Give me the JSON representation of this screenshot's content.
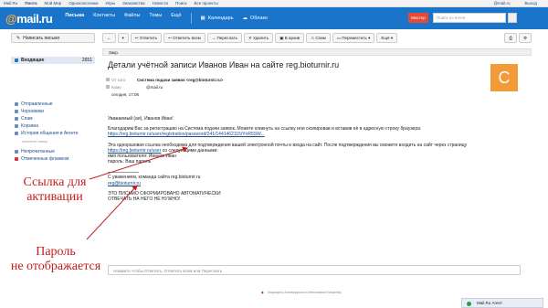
{
  "portal": {
    "items": [
      "Mail.Ru",
      "Почта",
      "Мой Мир",
      "Одноклассники",
      "Игры",
      "Знакомства",
      "Новости",
      "Поиск",
      "Все проекты"
    ],
    "right": [
      "@mail.ru",
      "Выход"
    ]
  },
  "header": {
    "logo_main": "@mail.ru",
    "nav": [
      "Письма",
      "Контакты",
      "Файлы",
      "Темы",
      "Ещё"
    ],
    "calendar": "Календарь",
    "cloud": "Облако",
    "red_button": "Мистер",
    "search_placeholder": "Поиск по почте"
  },
  "sidebar": {
    "compose": "Написать письмо",
    "inbox": "Входящие",
    "inbox_count": "2651",
    "folders": [
      "Отправленные",
      "Черновики",
      "Спам",
      "Корзина",
      "История общения в Агенте"
    ],
    "clear": "очистить папку",
    "unread": "Непрочитанные",
    "flagged": "Отмеченные флажком"
  },
  "toolbar": {
    "buttons": [
      "Ответить",
      "Ответить всем",
      "Переслать",
      "Удалить",
      "В архив",
      "Спам",
      "Переместить",
      "Ещё"
    ]
  },
  "tabbar": {
    "label": "Закр."
  },
  "message": {
    "subject": "Детали учётной записи Иванов Иван на сайте reg.bioturnir.ru",
    "avatar_letter": "С",
    "from_key": "От кого",
    "from_val": "Система подачи заявок <reg@bioturnir.ru>",
    "to_key": "Кому",
    "to_val": "@mail.ru",
    "date": "сегодня, 17:06",
    "greeting": "Уважаемый (ая), Иванов Иван!",
    "p1": "Благодарим Вас за регистрацию на Система подачи заявок. Можете кликнуть на ссылку или скопировав и вставив её в адресную строку браузера:",
    "link1": "https://reg.bioturnir.ru/user/registration/password/241/1441462115/YnR5SW...",
    "p2": "Эта одноразовая ссылка необходима для подтверждения вашей электронной почты и входа на сайт. После подтверждения вы сможете входить на сайт через страницу",
    "link2": "https://reg.bioturnir.ru/user",
    "p2b": "со следующими данными:",
    "username": "имя пользователя: Иванов Иван",
    "password": "пароль: Ваш пароль",
    "sign1": "С уважением, команда сайта reg.bioturnir.ru",
    "sign_email": "reg@bioturnir.ru",
    "auto1": "ЭТО ПИСЬМО СФОРМИРОВАНО АВТОМАТИЧЕСКИ",
    "auto2": "ОТВЕЧАТЬ НА НЕГО НЕ НУЖНО!"
  },
  "annotations": {
    "link_note_1": "Ссылка для",
    "link_note_2": "активации",
    "pass_note_1": "Пароль",
    "pass_note_2": "не отображается"
  },
  "reply_placeholder": "Нажмите чтобы Ответить, Ответить всем или Переслать",
  "footer": "Защищено Антивирусом и Антиспамом Kaspersky",
  "agent": "Mail.Ru Агент",
  "colors": {
    "header": "#1a74c9",
    "avatar": "#f39b38",
    "annotation": "#c41c1c"
  }
}
